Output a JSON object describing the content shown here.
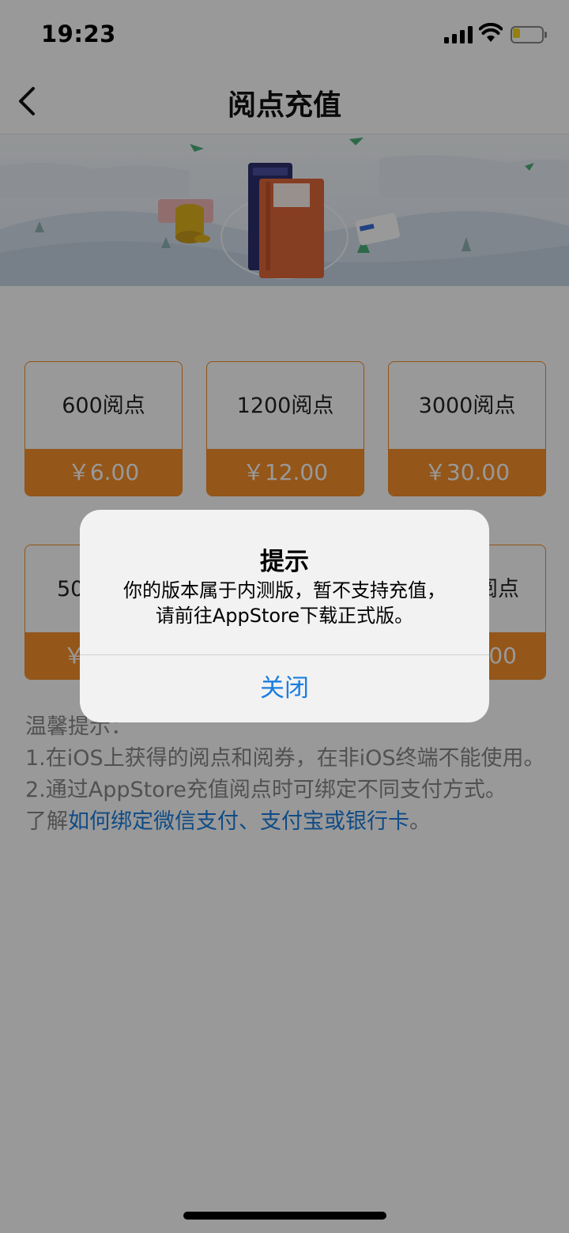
{
  "status_bar": {
    "time": "19:23",
    "battery_color": "#f7d51d"
  },
  "nav": {
    "title": "阅点充值",
    "back_icon": "chevron-left-icon"
  },
  "packages": [
    {
      "amount": "600阅点",
      "price": "￥6.00"
    },
    {
      "amount": "1200阅点",
      "price": "￥12.00"
    },
    {
      "amount": "3000阅点",
      "price": "￥30.00"
    },
    {
      "amount": "50",
      "price": "￥"
    },
    {
      "amount": "",
      "price": ""
    },
    {
      "amount": "阅点",
      "price": "00"
    }
  ],
  "tips": {
    "heading": "温馨提示：",
    "line1": "1.在iOS上获得的阅点和阅券，在非iOS终端不能使用。",
    "line2": "2.通过AppStore充值阅点时可绑定不同支付方式。",
    "line3_prefix": "了解",
    "line3_link": "如何绑定微信支付、支付宝或银行卡",
    "line3_suffix": "。"
  },
  "dialog": {
    "title": "提示",
    "message_line1": "你的版本属于内测版，暂不支持充值，",
    "message_line2": "请前往AppStore下载正式版。",
    "close_label": "关闭"
  },
  "colors": {
    "accent": "#f7902a",
    "link": "#1a7ee0"
  }
}
